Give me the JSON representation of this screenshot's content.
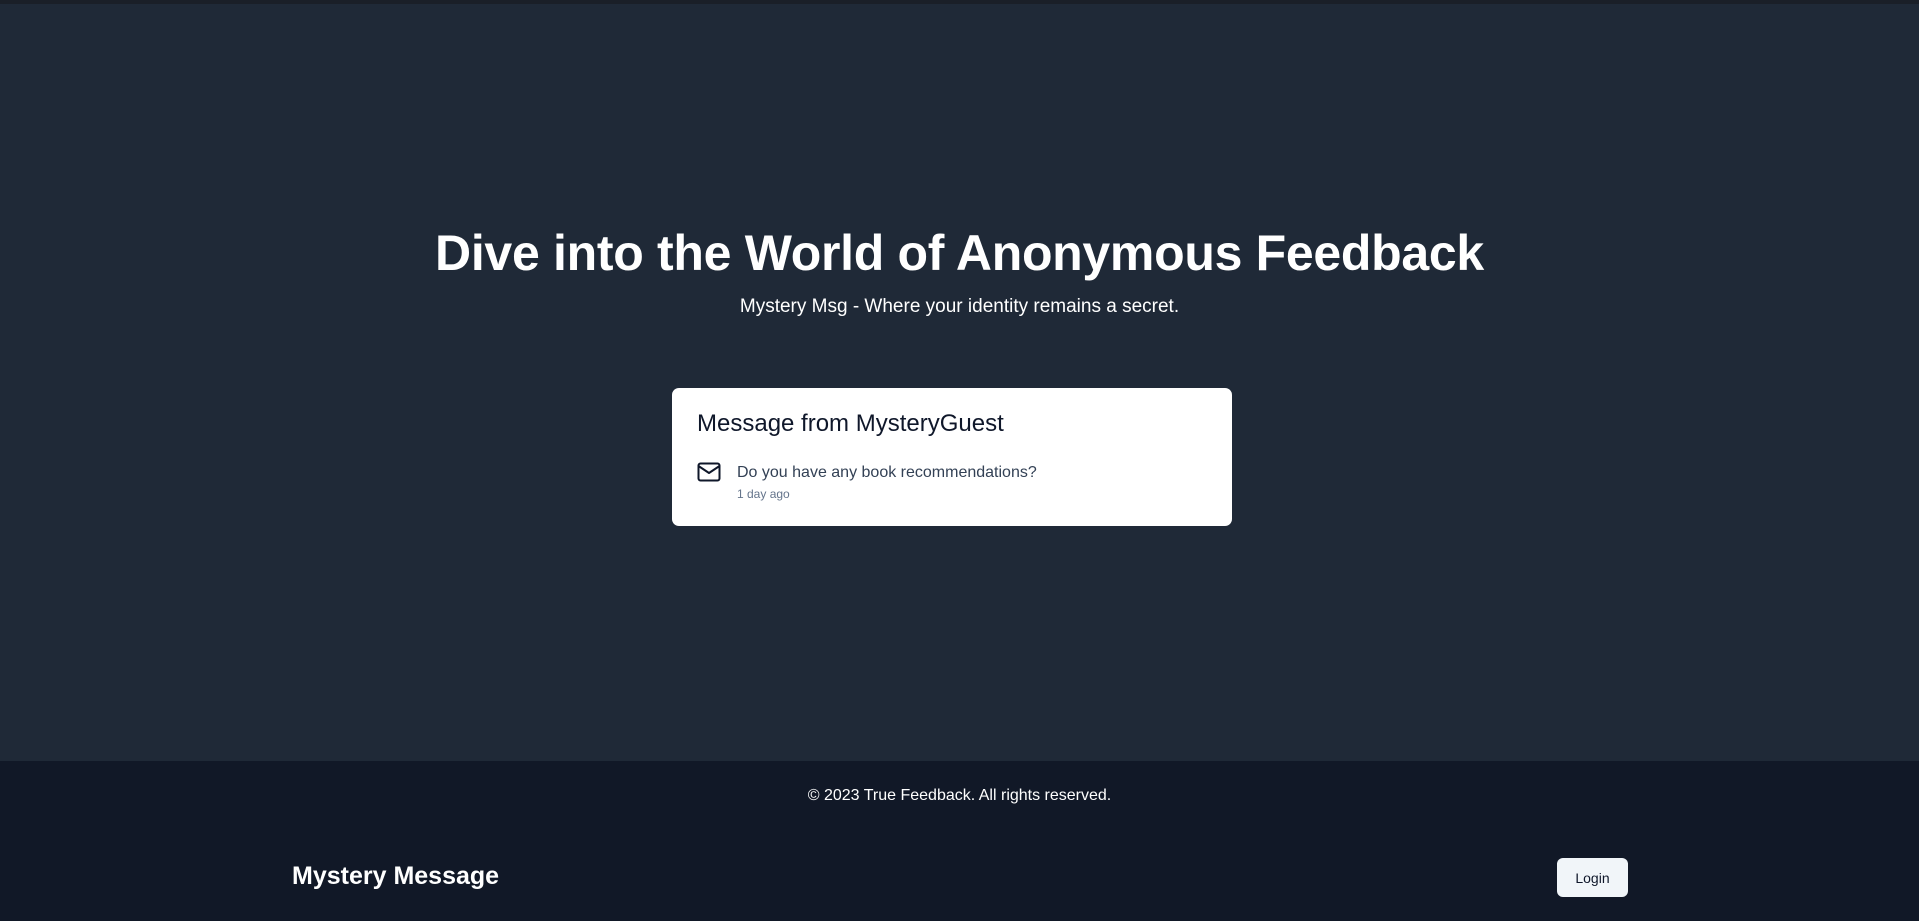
{
  "hero": {
    "title": "Dive into the World of Anonymous Feedback",
    "subtitle": "Mystery Msg - Where your identity remains a secret."
  },
  "message_card": {
    "title": "Message from MysteryGuest",
    "icon": "mail-icon",
    "content": "Do you have any book recommendations?",
    "time": "1 day ago"
  },
  "footer": {
    "copyright": "© 2023 True Feedback. All rights reserved."
  },
  "navbar": {
    "brand": "Mystery Message",
    "login_label": "Login"
  },
  "colors": {
    "main_bg": "#1f2937",
    "footer_bg": "#111827",
    "card_bg": "#ffffff",
    "button_bg": "#f1f5f9"
  }
}
